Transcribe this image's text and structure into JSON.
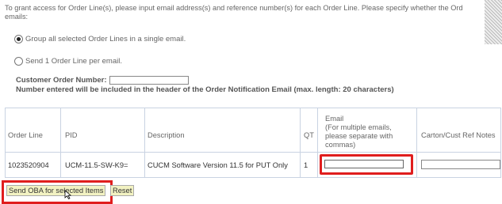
{
  "intro": {
    "text_line1": "To grant access for Order Line(s), please input email address(s) and reference number(s) for each Order Line.  Please specify whether the Ord",
    "text_line2": "emails:"
  },
  "options": {
    "group_all": "Group all selected Order Lines in a single email.",
    "send_one": "Send 1 Order Line per email."
  },
  "customer_order": {
    "label": "Customer Order Number:",
    "value": "",
    "note": "Number entered will be included in the header of the Order Notification Email (max. length: 20 characters)"
  },
  "table": {
    "columns": {
      "order_line": "Order Line",
      "pid": "PID",
      "description": "Description",
      "qty": "QT",
      "email_line1": "Email",
      "email_line2": "(For multiple emails,",
      "email_line3": "please separate with",
      "email_line4": "commas)",
      "carton": "Carton/Cust Ref Notes"
    },
    "row": {
      "order_line": "1023520904",
      "pid": "UCM-11.5-SW-K9=",
      "description": "CUCM Software Version 11.5 for PUT Only",
      "qty": "1",
      "email": "",
      "carton": ""
    }
  },
  "actions": {
    "send": "Send OBA for selected Items",
    "reset": "Reset"
  },
  "colors": {
    "highlight": "#e01e1e",
    "button_bg": "#f2f2c2",
    "grid_line": "#c9d3e2"
  }
}
